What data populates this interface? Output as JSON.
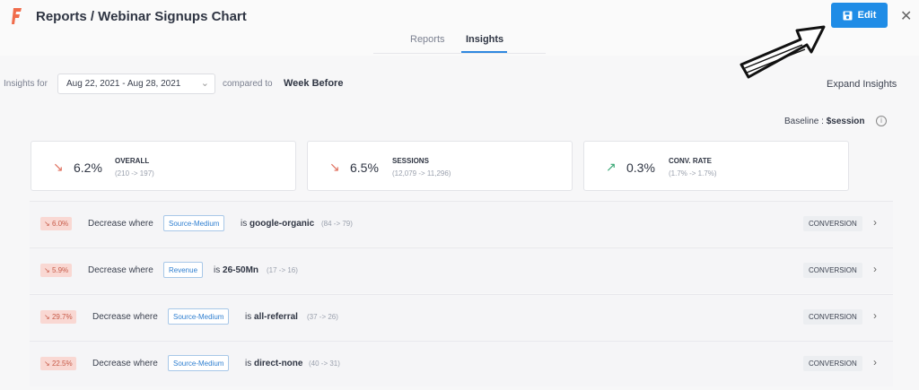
{
  "header": {
    "title": "Reports / Webinar Signups Chart",
    "edit_label": "Edit",
    "close_symbol": "✕",
    "accent": "#1f8ce6"
  },
  "tabs": [
    {
      "label": "Reports",
      "active": false
    },
    {
      "label": "Insights",
      "active": true
    }
  ],
  "filters": {
    "insights_for_label": "Insights for",
    "date_range": "Aug 22, 2021 - Aug 28, 2021",
    "compared_to_label": "compared to",
    "compared_value": "Week Before",
    "expand_label": "Expand Insights"
  },
  "baseline": {
    "label": "Baseline :",
    "value": "$session",
    "info_symbol": "i"
  },
  "metrics": [
    {
      "icon": "trend-down-icon",
      "value": "6.2%",
      "name": "OVERALL",
      "range": "(210 -> 197)"
    },
    {
      "icon": "trend-down-icon",
      "value": "6.5%",
      "name": "SESSIONS",
      "range": "(12,079 -> 11,296)"
    },
    {
      "icon": "trend-up-icon",
      "value": "0.3%",
      "name": "CONV. RATE",
      "range": "(1.7% -> 1.7%)"
    }
  ],
  "insights": [
    {
      "pct": "6.0%",
      "text": "Decrease where",
      "property": "Source-Medium",
      "is": "is",
      "value": "google-organic",
      "counts": "(84 -> 79)",
      "type": "CONVERSION"
    },
    {
      "pct": "5.9%",
      "text": "Decrease where",
      "property": "Revenue",
      "is": "is",
      "value": "26-50Mn",
      "counts": "(17 -> 16)",
      "type": "CONVERSION"
    },
    {
      "pct": "29.7%",
      "text": "Decrease where",
      "property": "Source-Medium",
      "is": "is",
      "value": "all-referral",
      "counts": "(37 -> 26)",
      "type": "CONVERSION"
    },
    {
      "pct": "22.5%",
      "text": "Decrease where",
      "property": "Source-Medium",
      "is": "is",
      "value": "direct-none",
      "counts": "(40 -> 31)",
      "type": "CONVERSION"
    }
  ]
}
